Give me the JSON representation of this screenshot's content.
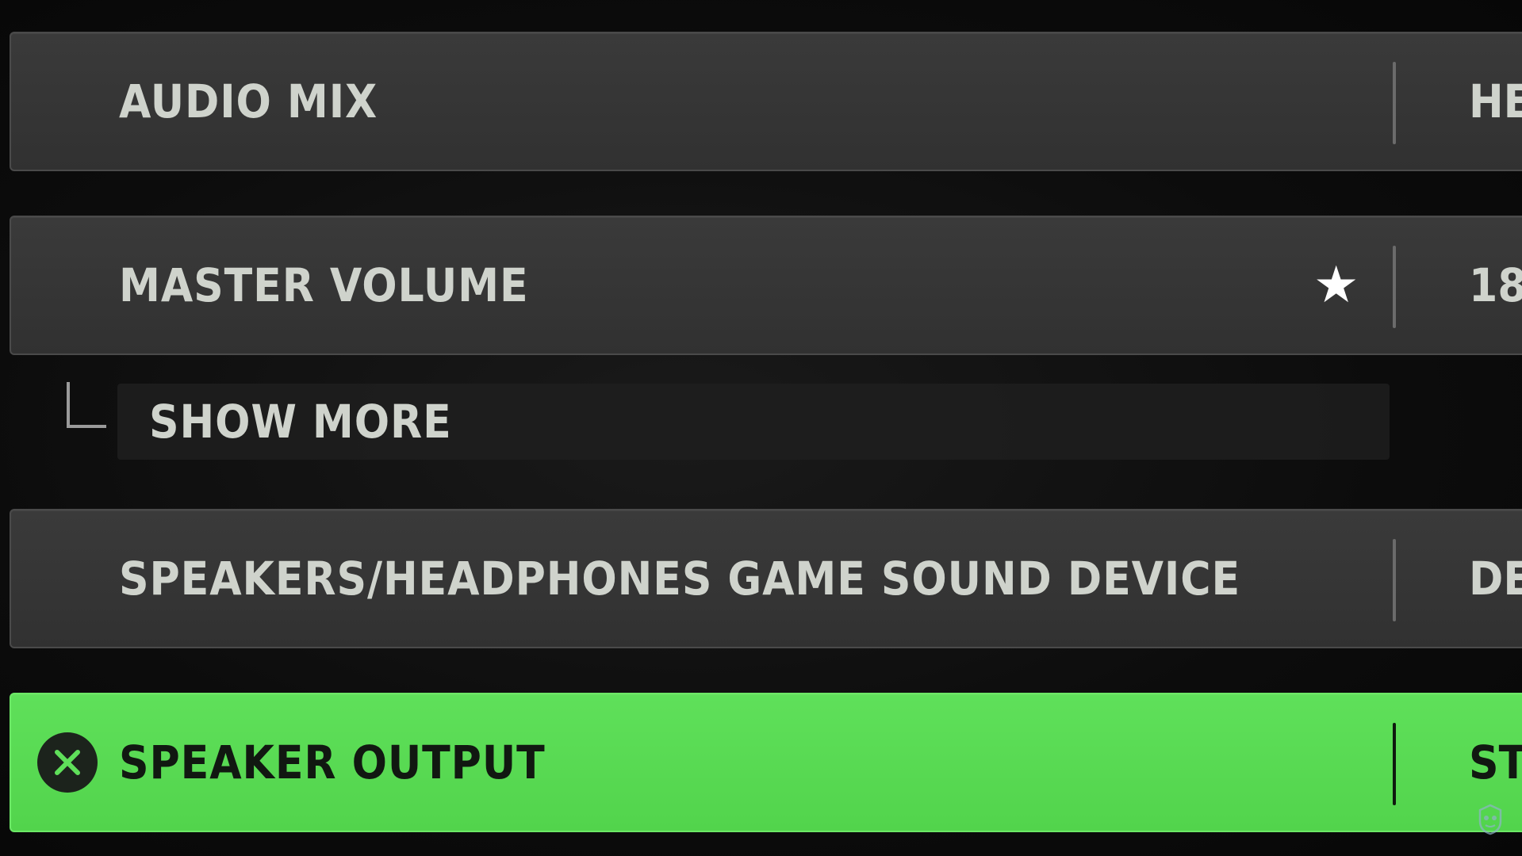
{
  "settings": {
    "rows": [
      {
        "label": "AUDIO MIX",
        "value": "HE"
      },
      {
        "label": "MASTER VOLUME",
        "value": "18"
      },
      {
        "label": "SPEAKERS/HEADPHONES GAME SOUND DEVICE",
        "value": "DE"
      },
      {
        "label": "SPEAKER OUTPUT",
        "value": "ST"
      }
    ],
    "show_more_label": "SHOW MORE"
  },
  "icons": {
    "favorite": "star-icon",
    "back": "close-circle-icon",
    "watermark": "logo-watermark-icon"
  },
  "colors": {
    "selected_row": "#5fe05a",
    "row_background": "#363636",
    "text": "#cfd3cc"
  }
}
